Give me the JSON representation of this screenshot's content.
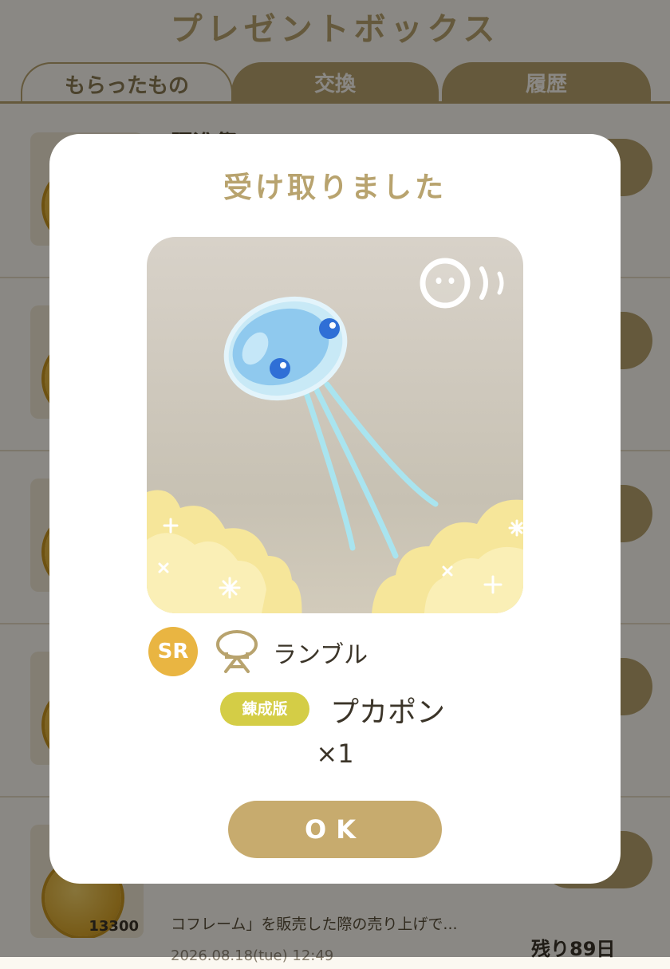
{
  "header": {
    "title": "プレゼントボックス"
  },
  "tabs": [
    {
      "label": "もらったもの"
    },
    {
      "label": "交換"
    },
    {
      "label": "履歴"
    }
  ],
  "list": {
    "row1_title_partial": "躍進祭",
    "last_item": {
      "count": "13300",
      "description": "コフレーム」を販売した際の売り上げで...",
      "date": "2026.08.18(tue) 12:49",
      "remaining": "残り89日"
    }
  },
  "modal": {
    "title": "受け取りました",
    "rarity": "SR",
    "type_icon": "lamp-icon",
    "card_name": "ランブル",
    "badge": "錬成版",
    "item_name": "プカポン",
    "quantity": "×1",
    "ok_label": "OK"
  },
  "colors": {
    "gold": "#b8a36e",
    "ok_button": "#c7ab6e",
    "rarity": "#e9b542",
    "badge": "#d4cd46",
    "text": "#3b3428"
  }
}
